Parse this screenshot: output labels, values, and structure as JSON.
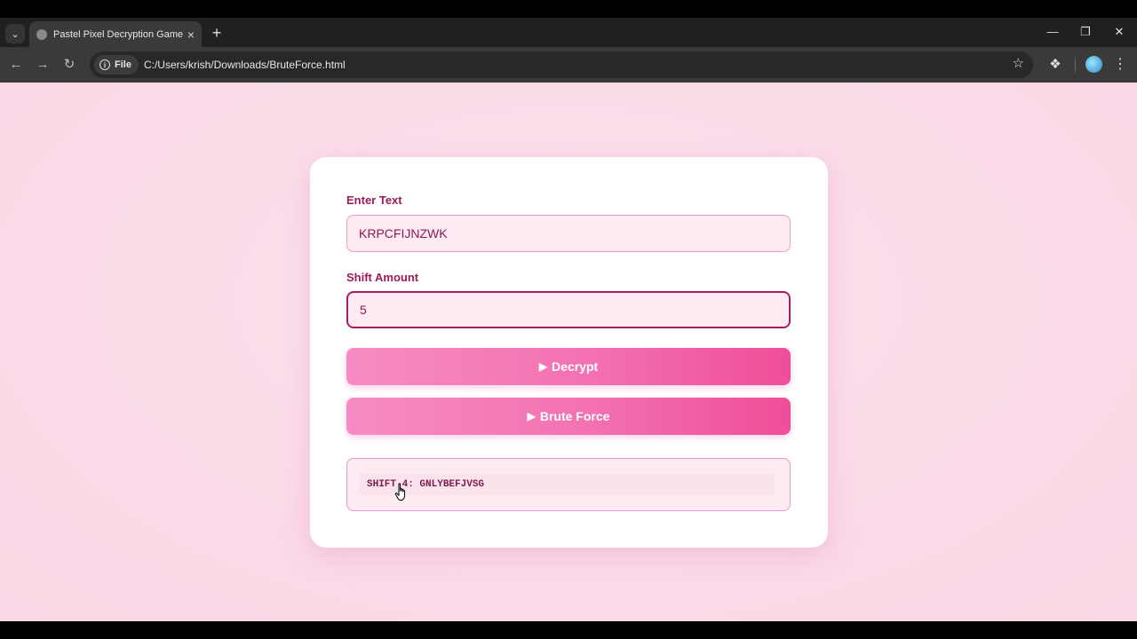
{
  "browser": {
    "tab_title": "Pastel Pixel Decryption Game",
    "file_chip": "File",
    "url": "C:/Users/krish/Downloads/BruteForce.html"
  },
  "form": {
    "text_label": "Enter Text",
    "text_value": "KRPCFIJNZWK",
    "shift_label": "Shift Amount",
    "shift_value": "5"
  },
  "buttons": {
    "decrypt_label": "Decrypt",
    "brute_force_label": "Brute Force"
  },
  "result": {
    "line": "SHIFT 4: GNLYBEFJVSG"
  },
  "colors": {
    "accent": "#ef4d98",
    "label": "#9b1b5a",
    "page_bg": "#fadbe8"
  }
}
